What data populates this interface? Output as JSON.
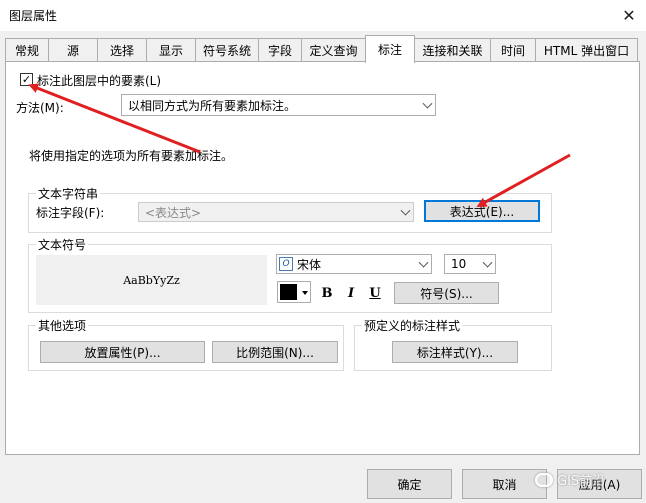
{
  "window": {
    "title": "图层属性",
    "close": "✕"
  },
  "tabs": [
    {
      "label": "常规"
    },
    {
      "label": "源"
    },
    {
      "label": "选择"
    },
    {
      "label": "显示"
    },
    {
      "label": "符号系统"
    },
    {
      "label": "字段"
    },
    {
      "label": "定义查询"
    },
    {
      "label": "标注"
    },
    {
      "label": "连接和关联"
    },
    {
      "label": "时间"
    },
    {
      "label": "HTML 弹出窗口"
    }
  ],
  "active_tab": "标注",
  "label_features": {
    "text": "标注此图层中的要素(L)",
    "checked": true,
    "checkmark": "✓"
  },
  "method": {
    "label": "方法(M):",
    "value": "以相同方式为所有要素加标注。"
  },
  "description": "将使用指定的选项为所有要素加标注。",
  "text_string": {
    "title": "文本字符串",
    "field_label": "标注字段(F):",
    "field_value": "<表达式>",
    "expression_button": "表达式(E)..."
  },
  "text_symbol": {
    "title": "文本符号",
    "preview": "AaBbYyZz",
    "font_value": "宋体",
    "font_icon": "O",
    "size_value": "10",
    "bold": "B",
    "italic": "I",
    "underline": "U",
    "symbol_button": "符号(S)...",
    "color": "#000000"
  },
  "other_options": {
    "title": "其他选项",
    "placement_button": "放置属性(P)...",
    "scale_button": "比例范围(N)..."
  },
  "predefined": {
    "title": "预定义的标注样式",
    "style_button": "标注样式(Y)..."
  },
  "footer": {
    "ok": "确定",
    "cancel": "取消",
    "apply": "应用(A)",
    "watermark": "GIS前沿"
  },
  "colors": {
    "arrow": "#e02020",
    "focus": "#0078d7"
  }
}
